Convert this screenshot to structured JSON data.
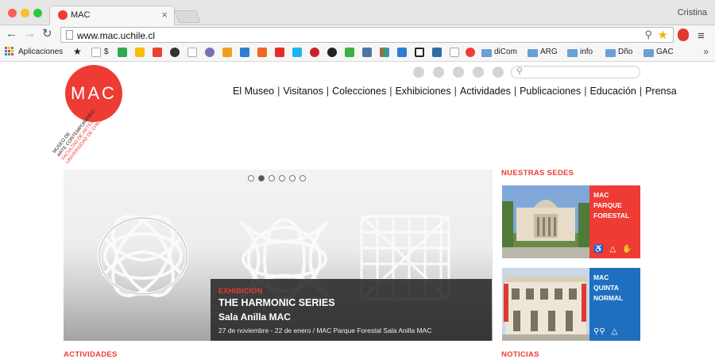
{
  "browser": {
    "tab_title": "MAC",
    "tab_close": "×",
    "profile_name": "Cristina",
    "url": "www.mac.uchile.cl",
    "nav": {
      "back": "←",
      "forward": "→",
      "reload": "↻"
    },
    "menu_glyph": "≡",
    "bookmarks": {
      "apps_label": "Aplicaciones",
      "dollar_label": "$",
      "folders": [
        "diCom",
        "ARG",
        "info",
        "Dño",
        "GAC"
      ],
      "more": "»"
    }
  },
  "site": {
    "logo_text": "MAC",
    "logo_lines_black": [
      "MUSEO DE",
      "ARTE CONTEMPORÁNEO"
    ],
    "logo_lines_red": [
      "FACULTAD DE ARTES",
      "UNIVERSIDAD DE CHILE"
    ],
    "nav": [
      "El Museo",
      "Visitanos",
      "Colecciones",
      "Exhibiciones",
      "Actividades",
      "Publicaciones",
      "Educación",
      "Prensa"
    ],
    "nav_separator": "|",
    "hero": {
      "kicker": "EXHIBICIÓN",
      "title": "THE HARMONIC SERIES",
      "subtitle": "Sala Anilla MAC",
      "dates": "27 de noviembre - 22 de enero / MAC Parque Forestal Sala Anilla MAC",
      "slides_total": 6,
      "slide_active": 2
    },
    "sections": {
      "nuestras_sedes": "NUESTRAS SEDES",
      "actividades": "ACTIVIDADES",
      "noticias": "NOTICIAS"
    },
    "sedes": [
      {
        "name_lines": [
          "MAC",
          "PARQUE",
          "FORESTAL"
        ],
        "color": "#ee3b34"
      },
      {
        "name_lines": [
          "MAC",
          "QUINTA",
          "NORMAL"
        ],
        "color": "#1f6fc0"
      }
    ],
    "colors": {
      "brand_red": "#ee3b34",
      "brand_blue": "#1f6fc0"
    }
  }
}
